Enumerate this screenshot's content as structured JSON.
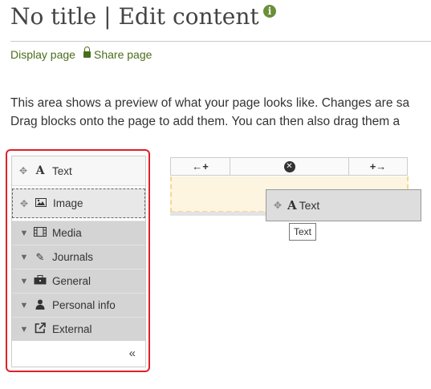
{
  "page": {
    "title": "No title | Edit content",
    "info_icon": "info-icon",
    "links": {
      "display": "Display page",
      "share": "Share page"
    },
    "description": {
      "line1": "This area shows a preview of what your page looks like. Changes are sa",
      "line2": "Drag blocks onto the page to add them. You can then also drag them a"
    },
    "colors": {
      "accent": "#4a6d1c",
      "highlight": "#e0202a"
    }
  },
  "sidebar": {
    "blocks": [
      {
        "label": "Text",
        "icon": "text-icon"
      },
      {
        "label": "Image",
        "icon": "image-icon"
      }
    ],
    "categories": [
      {
        "label": "Media",
        "icon": "film-icon"
      },
      {
        "label": "Journals",
        "icon": "pencil-icon"
      },
      {
        "label": "General",
        "icon": "briefcase-icon"
      },
      {
        "label": "Personal info",
        "icon": "person-icon"
      },
      {
        "label": "External",
        "icon": "external-link-icon"
      }
    ],
    "collapse_glyph": "«"
  },
  "canvas": {
    "toolbar": {
      "add_left": "←+",
      "remove": "✕",
      "add_right": "+→"
    },
    "drag_ghost": {
      "label": "Text",
      "icon": "text-icon"
    },
    "tooltip": "Text"
  }
}
